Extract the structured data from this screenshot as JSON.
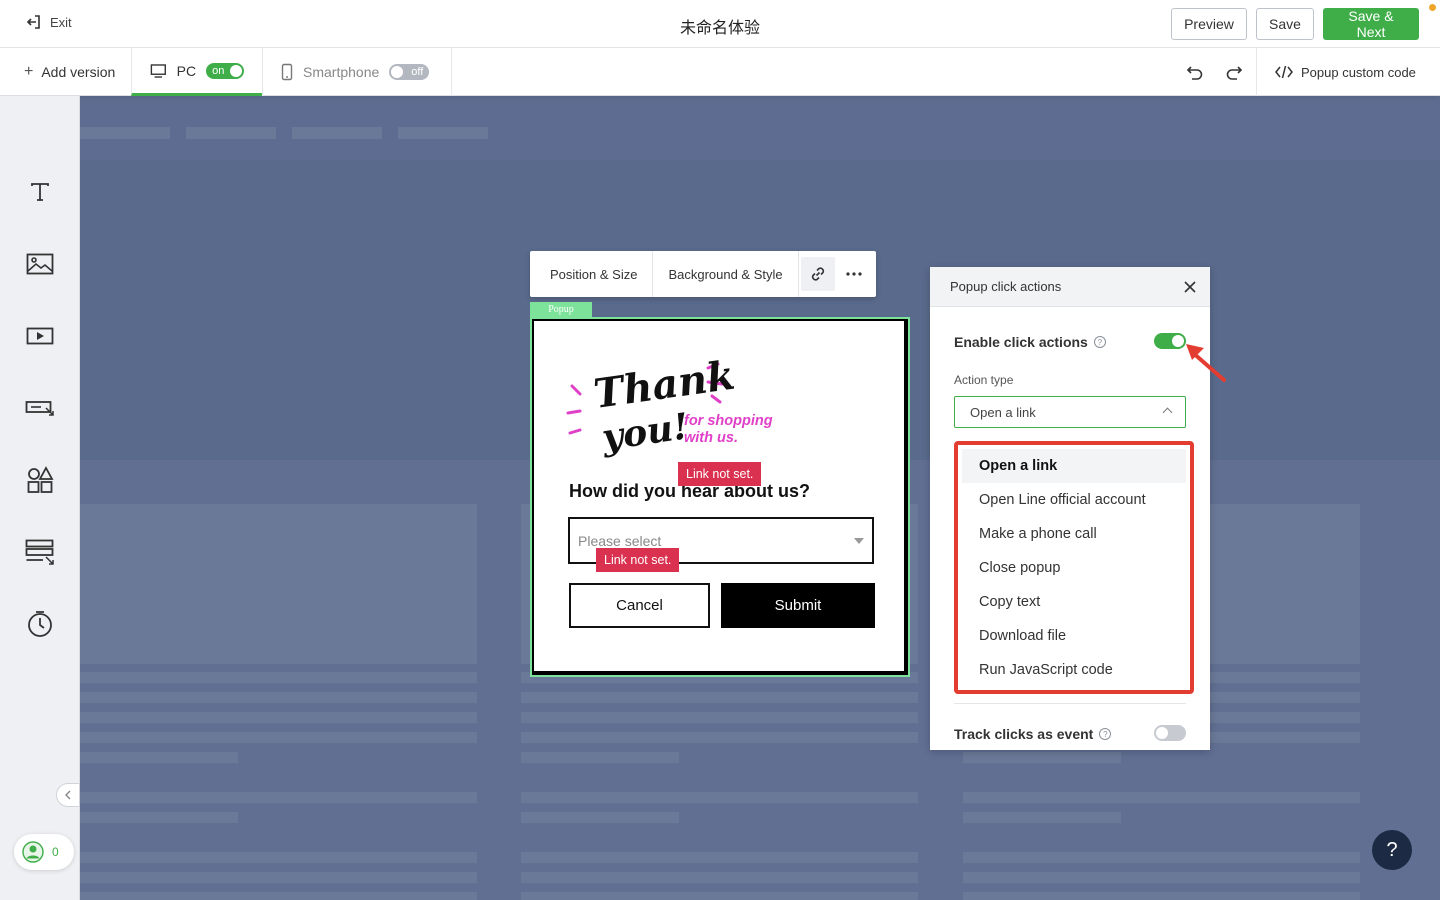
{
  "header": {
    "exit_label": "Exit",
    "title": "未命名体验",
    "preview_label": "Preview",
    "save_label": "Save",
    "save_next_label": "Save & Next"
  },
  "subbar": {
    "add_version_label": "Add version",
    "devices": [
      {
        "label": "PC",
        "toggle": "on",
        "active": true
      },
      {
        "label": "Smartphone",
        "toggle": "off",
        "active": false
      }
    ],
    "custom_code_label": "Popup custom code"
  },
  "sidebar": {
    "tools": [
      "text-icon",
      "image-icon",
      "video-icon",
      "button-icon",
      "shapes-icon",
      "form-icon",
      "timer-icon"
    ],
    "user_count": "0"
  },
  "float_toolbar": {
    "position_size_label": "Position & Size",
    "background_style_label": "Background & Style"
  },
  "popup": {
    "tag_label": "Popup",
    "heading_line1": "Thank",
    "heading_line2": "you!",
    "sub_line1": "for shopping",
    "sub_line2": "with us.",
    "question": "How did you hear about us?",
    "select_placeholder": "Please select",
    "cancel_label": "Cancel",
    "submit_label": "Submit",
    "warning_1": "Link not set.",
    "warning_2": "Link not set."
  },
  "panel": {
    "title": "Popup click actions",
    "enable_label": "Enable click actions",
    "enable_on": true,
    "action_type_label": "Action type",
    "action_type_value": "Open a link",
    "options": [
      "Open a link",
      "Open Line official account",
      "Make a phone call",
      "Close popup",
      "Copy text",
      "Download file",
      "Run JavaScript code"
    ],
    "track_label": "Track clicks as event",
    "track_on": false
  },
  "help_label": "?",
  "colors": {
    "accent": "#3fae49",
    "warning": "#d9314f",
    "highlight_border": "#e33c31",
    "thank_you_pink": "#e040c8",
    "canvas": "#5a6a8c"
  }
}
